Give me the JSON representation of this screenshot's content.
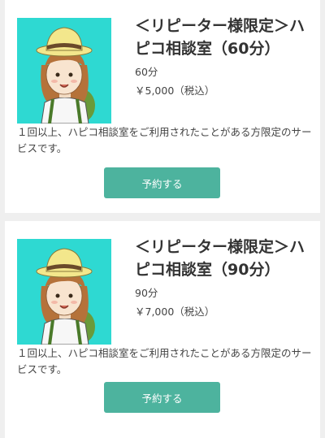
{
  "colors": {
    "page_background": "#efefef",
    "card_background": "#ffffff",
    "thumbnail_background": "#2ed9d2",
    "button_background": "#4db39e",
    "button_text": "#ffffff"
  },
  "services": [
    {
      "title": "＜リピーター様限定＞ハピコ相談室（60分）",
      "duration": "60分",
      "price": "￥5,000（税込）",
      "description": "１回以上、ハピコ相談室をご利用されたことがある方限定のサービスです。",
      "button_label": "予約する",
      "thumbnail_icon": "counselor-avatar-illustration"
    },
    {
      "title": "＜リピーター様限定＞ハピコ相談室（90分）",
      "duration": "90分",
      "price": "￥7,000（税込）",
      "description": "１回以上、ハピコ相談室をご利用されたことがある方限定のサービスです。",
      "button_label": "予約する",
      "thumbnail_icon": "counselor-avatar-illustration"
    }
  ]
}
